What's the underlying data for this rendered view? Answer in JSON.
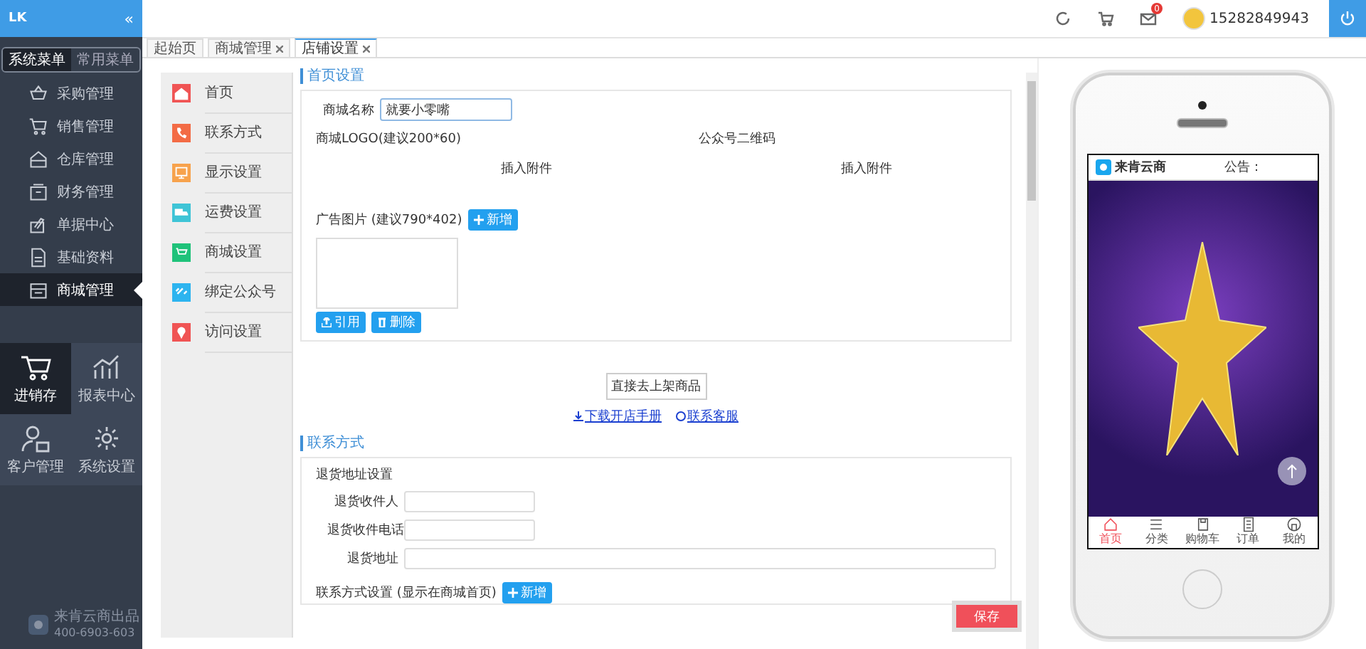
{
  "sidebar": {
    "logo": "LK",
    "collapse": "«",
    "menu_switch": [
      {
        "label": "系统菜单",
        "selected": true
      },
      {
        "label": "常用菜单",
        "selected": false
      }
    ],
    "items": [
      {
        "label": "采购管理",
        "selected": false
      },
      {
        "label": "销售管理",
        "selected": false
      },
      {
        "label": "仓库管理",
        "selected": false
      },
      {
        "label": "财务管理",
        "selected": false
      },
      {
        "label": "单据中心",
        "selected": false
      },
      {
        "label": "基础资料",
        "selected": false
      },
      {
        "label": "商城管理",
        "selected": true
      }
    ],
    "tiles": [
      {
        "label": "进销存",
        "selected": true
      },
      {
        "label": "报表中心",
        "selected": false
      },
      {
        "label": "客户管理",
        "selected": false
      },
      {
        "label": "系统设置",
        "selected": false
      }
    ],
    "footer": {
      "brand": "来肯云商出品",
      "phone": "400-6903-603"
    }
  },
  "topbar": {
    "notification_count": "0",
    "username": "15282849943"
  },
  "tabs": [
    {
      "label": "起始页",
      "closable": false,
      "selected": false
    },
    {
      "label": "商城管理",
      "closable": true,
      "selected": false
    },
    {
      "label": "店铺设置",
      "closable": true,
      "selected": true
    }
  ],
  "subnav": {
    "items": [
      {
        "label": "首页",
        "color": "#f05454"
      },
      {
        "label": "联系方式",
        "color": "#f36b45"
      },
      {
        "label": "显示设置",
        "color": "#f7a24c"
      },
      {
        "label": "运费设置",
        "color": "#3ec4d6"
      },
      {
        "label": "商城设置",
        "color": "#1fc27a"
      },
      {
        "label": "绑定公众号",
        "color": "#2db4ef"
      },
      {
        "label": "访问设置",
        "color": "#f05454"
      }
    ]
  },
  "home_settings": {
    "title": "首页设置",
    "shop_name": {
      "label": "商城名称",
      "value": "就要小零嘴"
    },
    "logo": {
      "label": "商城LOGO(建议200*60)",
      "attach": "插入附件"
    },
    "qrcode": {
      "label": "公众号二维码",
      "attach": "插入附件"
    },
    "ad_images": {
      "label": "广告图片 (建议790*402)",
      "add_button": "新增",
      "actions": [
        "引用",
        "删除"
      ]
    }
  },
  "shelf_button": "直接去上架商品",
  "links": [
    "下载开店手册",
    "联系客服"
  ],
  "contact": {
    "title": "联系方式",
    "subtitle": "退货地址设置",
    "fields": [
      {
        "label": "退货收件人",
        "kind": "short"
      },
      {
        "label": "退货收件电话",
        "kind": "short"
      },
      {
        "label": "退货地址",
        "kind": "long"
      }
    ],
    "more_label": "联系方式设置 (显示在商城首页)",
    "more_button": "新增"
  },
  "save_button": "保存",
  "phone": {
    "shop_name": "来肯云商",
    "notice": "公告：",
    "nav": [
      {
        "label": "首页",
        "selected": true
      },
      {
        "label": "分类",
        "selected": false
      },
      {
        "label": "购物车",
        "selected": false
      },
      {
        "label": "订单",
        "selected": false
      },
      {
        "label": "我的",
        "selected": false
      }
    ]
  }
}
